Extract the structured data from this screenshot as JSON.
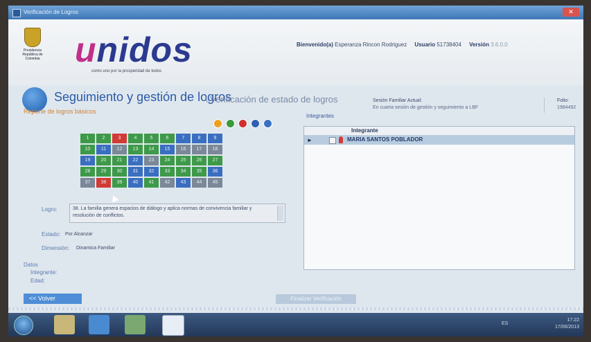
{
  "window": {
    "title": "Verificación de Logros"
  },
  "header": {
    "logo_text": "unidos",
    "slogan": "como uno por la prosperidad de todos",
    "crest_caption": "Presidencia República de Colombia",
    "welcome_label": "Bienvenido(a)",
    "welcome_name": "Esperanza Rincon Rodriguez",
    "usuario_label": "Usuario",
    "usuario_value": "51738404",
    "version_label": "Versión",
    "version_value": "3.6.0.0"
  },
  "section": {
    "title": "Seguimiento y gestión de logros",
    "subtitle": "\\ Verificación de estado de logros",
    "report_title": "Reporte de logros básicos",
    "sesion_label": "Sesión Familiar Actual:",
    "sesion_value": "En cuarta sesión de gestión y seguimiento a LBF",
    "folio_label": "Folio:",
    "folio_value": "1984492"
  },
  "status_circles": [
    "#f0a020",
    "#3a9a3a",
    "#d03030",
    "#3060b0",
    "#3a70c0"
  ],
  "logros_grid": [
    {
      "n": "1",
      "c": "#3e9a48"
    },
    {
      "n": "2",
      "c": "#3e9a48"
    },
    {
      "n": "3",
      "c": "#d23a34"
    },
    {
      "n": "4",
      "c": "#3e9a48"
    },
    {
      "n": "5",
      "c": "#3e9a48"
    },
    {
      "n": "6",
      "c": "#3e9a48"
    },
    {
      "n": "7",
      "c": "#3a6ec0"
    },
    {
      "n": "8",
      "c": "#3a6ec0"
    },
    {
      "n": "9",
      "c": "#3a6ec0"
    },
    {
      "n": "10",
      "c": "#3e9a48"
    },
    {
      "n": "11",
      "c": "#3a6ec0"
    },
    {
      "n": "12",
      "c": "#7a8898"
    },
    {
      "n": "13",
      "c": "#3e9a48"
    },
    {
      "n": "14",
      "c": "#3e9a48"
    },
    {
      "n": "15",
      "c": "#3a6ec0"
    },
    {
      "n": "16",
      "c": "#7a8898"
    },
    {
      "n": "17",
      "c": "#7a8898"
    },
    {
      "n": "18",
      "c": "#7a8898"
    },
    {
      "n": "19",
      "c": "#3a6ec0"
    },
    {
      "n": "20",
      "c": "#3e9a48"
    },
    {
      "n": "21",
      "c": "#3e9a48"
    },
    {
      "n": "22",
      "c": "#3a6ec0"
    },
    {
      "n": "23",
      "c": "#7a8898"
    },
    {
      "n": "24",
      "c": "#3e9a48"
    },
    {
      "n": "25",
      "c": "#3e9a48"
    },
    {
      "n": "26",
      "c": "#3e9a48"
    },
    {
      "n": "27",
      "c": "#3e9a48"
    },
    {
      "n": "28",
      "c": "#3e9a48"
    },
    {
      "n": "29",
      "c": "#3e9a48"
    },
    {
      "n": "30",
      "c": "#3e9a48"
    },
    {
      "n": "31",
      "c": "#3a6ec0"
    },
    {
      "n": "32",
      "c": "#3a6ec0"
    },
    {
      "n": "33",
      "c": "#3e9a48"
    },
    {
      "n": "34",
      "c": "#3e9a48"
    },
    {
      "n": "35",
      "c": "#3e9a48"
    },
    {
      "n": "36",
      "c": "#3a6ec0"
    },
    {
      "n": "37",
      "c": "#7a8898"
    },
    {
      "n": "38",
      "c": "#d23a34"
    },
    {
      "n": "39",
      "c": "#3e9a48"
    },
    {
      "n": "40",
      "c": "#3a6ec0"
    },
    {
      "n": "41",
      "c": "#3e9a48"
    },
    {
      "n": "42",
      "c": "#7a8898"
    },
    {
      "n": "43",
      "c": "#3a6ec0"
    },
    {
      "n": "44",
      "c": "#7a8898"
    },
    {
      "n": "45",
      "c": "#7a8898"
    }
  ],
  "detail": {
    "logro_label": "Logro:",
    "logro_value": "38. La familia genera espacios de diálogo y aplica normas de convivencia familiar y resolución de conflictos.",
    "estado_label": "Estado:",
    "estado_value": "Por Alcanzar",
    "dimension_label": "Dimensión:",
    "dimension_value": "Dinamica Familiar",
    "datos_label": "Datos",
    "integrante_label": "Integrante:",
    "edad_label": "Edad:"
  },
  "integrantes": {
    "label": "Integrantes",
    "column_header": "Integrante",
    "rows": [
      {
        "name": "MARIA SANTOS POBLADOR"
      }
    ]
  },
  "buttons": {
    "volver": "<< Volver",
    "finalizar": "Finalizar Verificación"
  },
  "taskbar": {
    "lang": "ES",
    "time": "17:22",
    "date": "17/06/2013"
  }
}
